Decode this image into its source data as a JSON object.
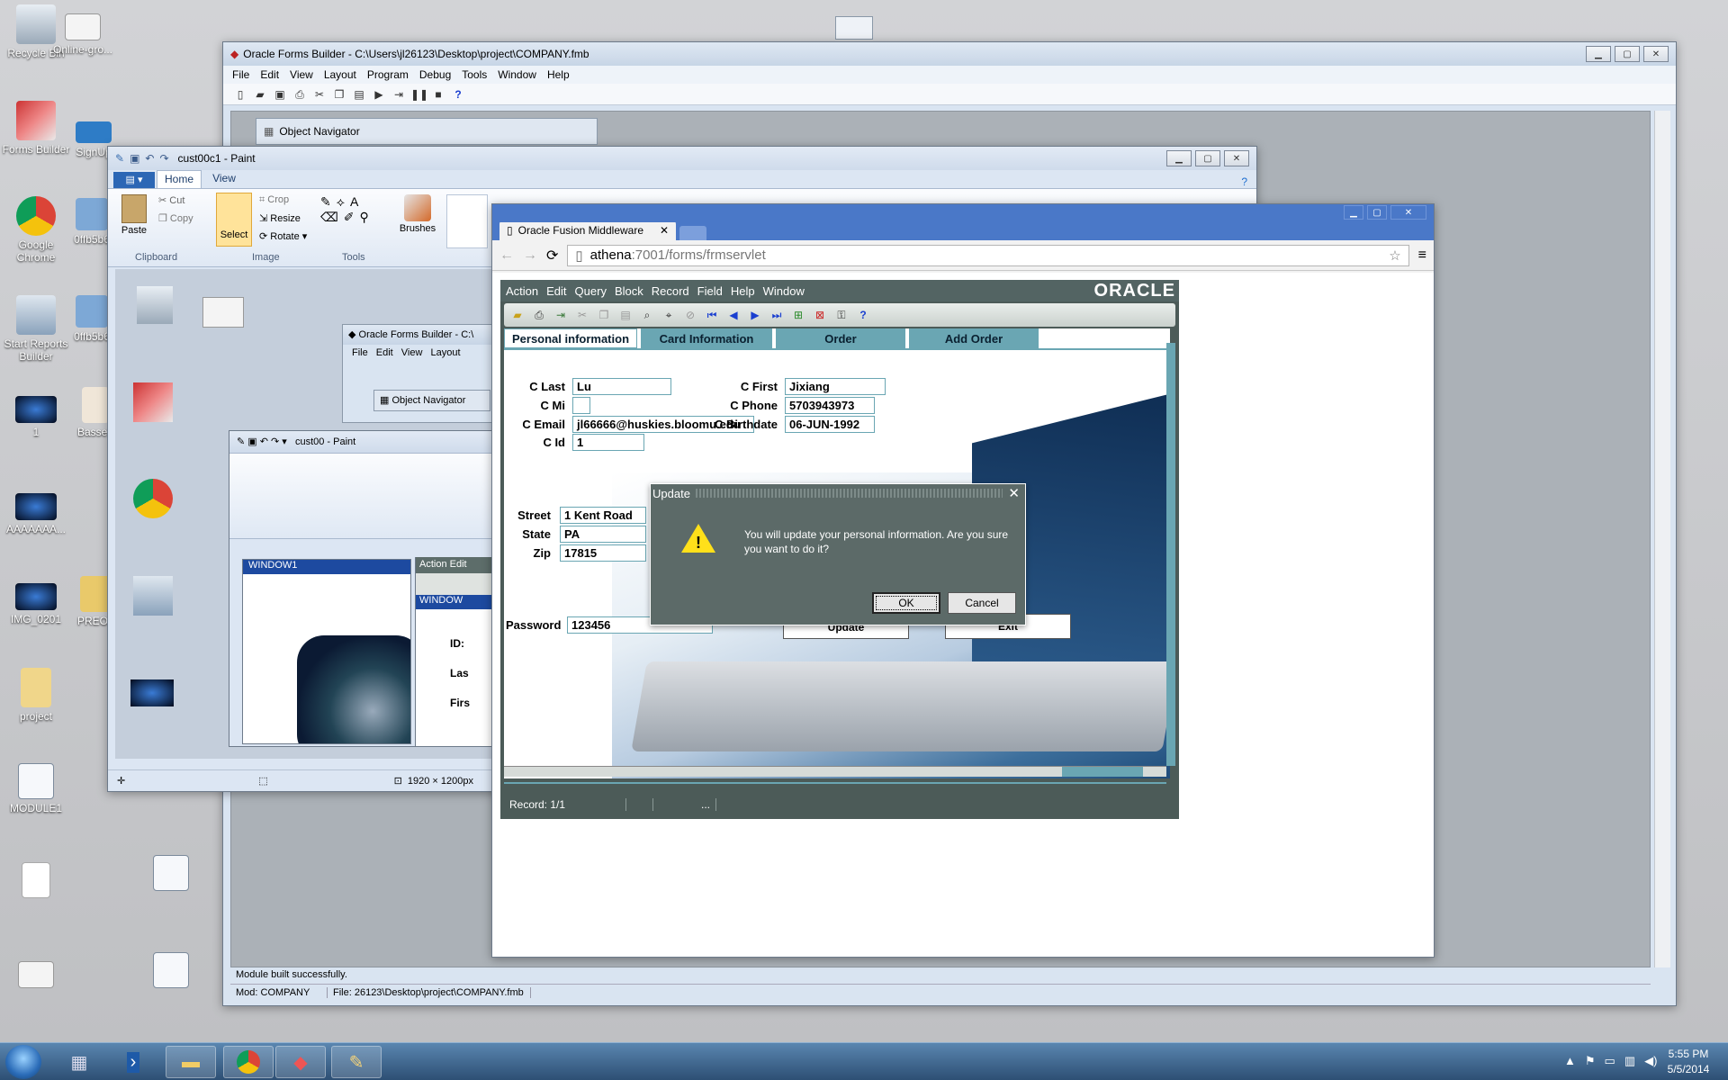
{
  "desktop_icons": [
    {
      "label": "Recycle Bin",
      "icon": "recycle-bin-icon"
    },
    {
      "label": "Online-gro...",
      "icon": "image-file-icon"
    },
    {
      "label": "Forms Builder",
      "icon": "forms-builder-icon"
    },
    {
      "label": "SignUp",
      "icon": "image-file-icon"
    },
    {
      "label": "Google Chrome",
      "icon": "chrome-icon"
    },
    {
      "label": "0ffb5b6",
      "icon": "image-file-icon"
    },
    {
      "label": "Start Reports Builder",
      "icon": "reports-builder-icon"
    },
    {
      "label": "0ffb5b6",
      "icon": "image-file-icon"
    },
    {
      "label": "1",
      "icon": "image-file-icon"
    },
    {
      "label": "Bassett",
      "icon": "image-file-icon"
    },
    {
      "label": "AAAAAAA...",
      "icon": "image-file-icon"
    },
    {
      "label": "IMG_0201",
      "icon": "image-file-icon"
    },
    {
      "label": "PREOJ",
      "icon": "folder-icon"
    },
    {
      "label": "project",
      "icon": "folder-icon"
    },
    {
      "label": "MODULE1",
      "icon": "form-module-icon"
    }
  ],
  "forms_builder": {
    "title": "Oracle Forms Builder - C:\\Users\\jl26123\\Desktop\\project\\COMPANY.fmb",
    "menu": [
      "File",
      "Edit",
      "View",
      "Layout",
      "Program",
      "Debug",
      "Tools",
      "Window",
      "Help"
    ],
    "object_navigator": "Object Navigator",
    "status_message": "Module built successfully.",
    "status_mod": "Mod: COMPANY",
    "status_file": "File: 26123\\Desktop\\project\\COMPANY.fmb"
  },
  "paint": {
    "title": "cust00c1 - Paint",
    "tabs": [
      "Home",
      "View"
    ],
    "clipboard": {
      "paste": "Paste",
      "cut": "Cut",
      "copy": "Copy",
      "group": "Clipboard"
    },
    "image": {
      "select": "Select",
      "crop": "Crop",
      "resize": "Resize",
      "rotate": "Rotate",
      "group": "Image"
    },
    "tools_group": "Tools",
    "brushes": "Brushes",
    "canvas_size": "1920 × 1200px"
  },
  "browser": {
    "tab_title": "Oracle Fusion Middleware",
    "url_host": "athena",
    "url_rest": ":7001/forms/frmservlet"
  },
  "oracle_form": {
    "menu": [
      "Action",
      "Edit",
      "Query",
      "Block",
      "Record",
      "Field",
      "Help",
      "Window"
    ],
    "logo": "ORACLE",
    "tabs": [
      "Personal information",
      "Card Information",
      "Order",
      "Add Order"
    ],
    "fields": {
      "c_last": {
        "label": "C Last",
        "value": "Lu"
      },
      "c_first": {
        "label": "C First",
        "value": "Jixiang"
      },
      "c_mi": {
        "label": "C Mi",
        "value": ""
      },
      "c_phone": {
        "label": "C Phone",
        "value": "5703943973"
      },
      "c_email": {
        "label": "C Email",
        "value": "jl66666@huskies.bloomu.edu"
      },
      "c_birthdate": {
        "label": "C Birthdate",
        "value": "06-JUN-1992"
      },
      "c_id": {
        "label": "C Id",
        "value": "1"
      },
      "street": {
        "label": "Street",
        "value": "1 Kent Road"
      },
      "state": {
        "label": "State",
        "value": "PA"
      },
      "zip": {
        "label": "Zip",
        "value": "17815"
      },
      "password": {
        "label": "Password",
        "value": "123456"
      }
    },
    "buttons": {
      "update": "Update",
      "exit": "Exit"
    },
    "status": "Record: 1/1",
    "dialog": {
      "title": "Update",
      "message": "You will update your personal information. Are you sure you want to do it?",
      "ok": "OK",
      "cancel": "Cancel"
    }
  },
  "taskbar": {
    "time": "5:55 PM",
    "date": "5/5/2014"
  }
}
